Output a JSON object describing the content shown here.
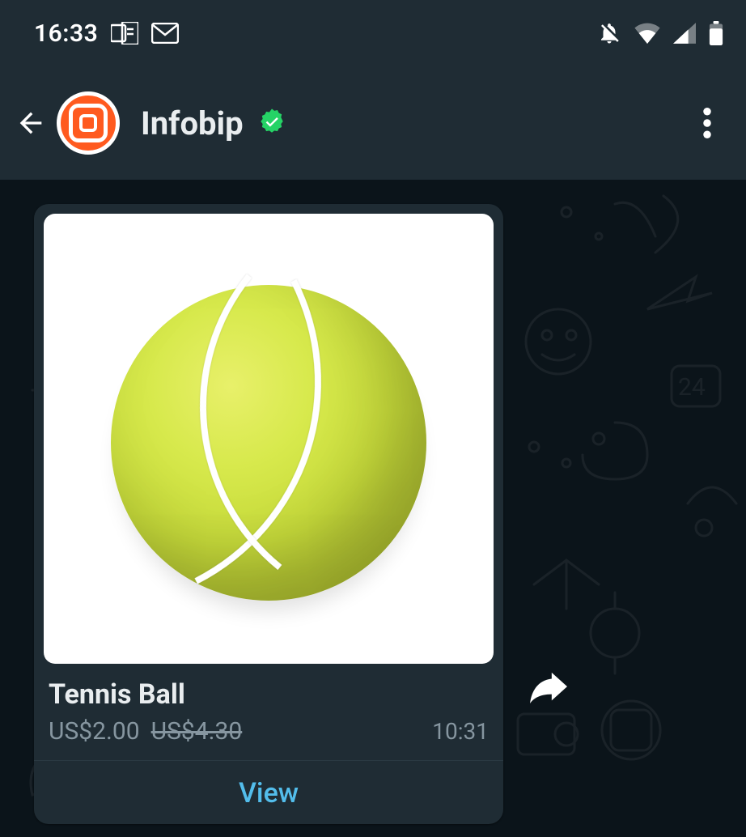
{
  "status_bar": {
    "time": "16:33",
    "icons": {
      "outlook": "outlook-icon",
      "mail": "mail-icon",
      "mute": "mute-icon",
      "wifi": "wifi-icon",
      "signal": "signal-icon",
      "battery": "battery-icon"
    }
  },
  "header": {
    "chat_name": "Infobip",
    "verified": true,
    "avatar_color": "#ff5a1f"
  },
  "message": {
    "product_title": "Tennis Ball",
    "price": "US$2.00",
    "old_price": "US$4.30",
    "timestamp": "10:31",
    "action_label": "View",
    "image_alt": "tennis-ball"
  }
}
